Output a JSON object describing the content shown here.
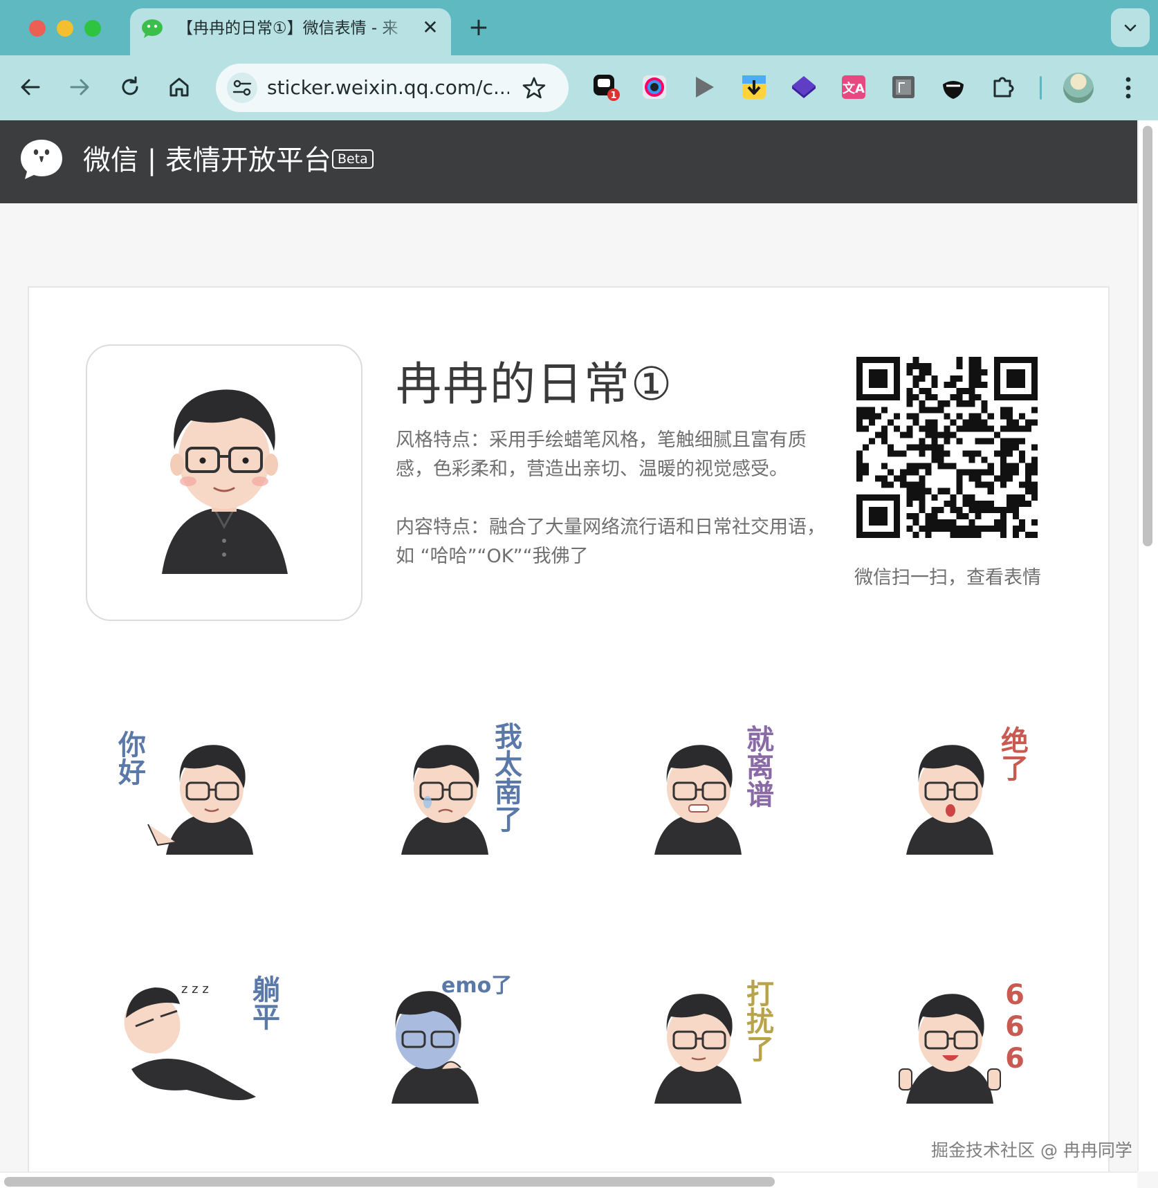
{
  "browser": {
    "tab": {
      "title": "【冉冉的日常①】微信表情 - 来",
      "close_label": "✕"
    },
    "new_tab_label": "+",
    "address": {
      "url": "sticker.weixin.qq.com/c..."
    },
    "extensions": [
      {
        "name": "ext-1",
        "badge": "1"
      },
      {
        "name": "ext-2"
      },
      {
        "name": "ext-3"
      },
      {
        "name": "ext-4"
      },
      {
        "name": "ext-5"
      },
      {
        "name": "ext-6",
        "label": "文A"
      },
      {
        "name": "ext-7"
      },
      {
        "name": "ext-8"
      },
      {
        "name": "extensions-puzzle"
      }
    ]
  },
  "site": {
    "brand": "微信 | 表情开放平台",
    "beta_badge": "Beta"
  },
  "pack": {
    "title": "冉冉的日常①",
    "style_desc": "风格特点：采用手绘蜡笔风格，笔触细腻且富有质感，色彩柔和，营造出亲切、温暖的视觉感受。",
    "content_desc": "内容特点：融合了大量网络流行语和日常社交用语，如 “哈哈”“OK”“我佛了",
    "qr_caption": "微信扫一扫，查看表情"
  },
  "stickers": [
    {
      "text": "你好",
      "color": "#5a79a8"
    },
    {
      "text": "我太南了",
      "color": "#5a79a8"
    },
    {
      "text": "就离谱",
      "color": "#8a6aa6"
    },
    {
      "text": "绝了",
      "color": "#c85a52"
    },
    {
      "text": "躺平",
      "color": "#5a79a8"
    },
    {
      "text": "emo了",
      "color": "#5a79a8"
    },
    {
      "text": "打扰了",
      "color": "#b8a24a"
    },
    {
      "text": "666",
      "color": "#c85a52"
    }
  ],
  "watermark": "掘金技术社区 @ 冉冉同学",
  "colors": {
    "chrome_tab_bar": "#5fb9c0",
    "chrome_toolbar": "#b7e1e3",
    "site_header": "#3c3d3f",
    "page_bg": "#f6f6f6"
  }
}
